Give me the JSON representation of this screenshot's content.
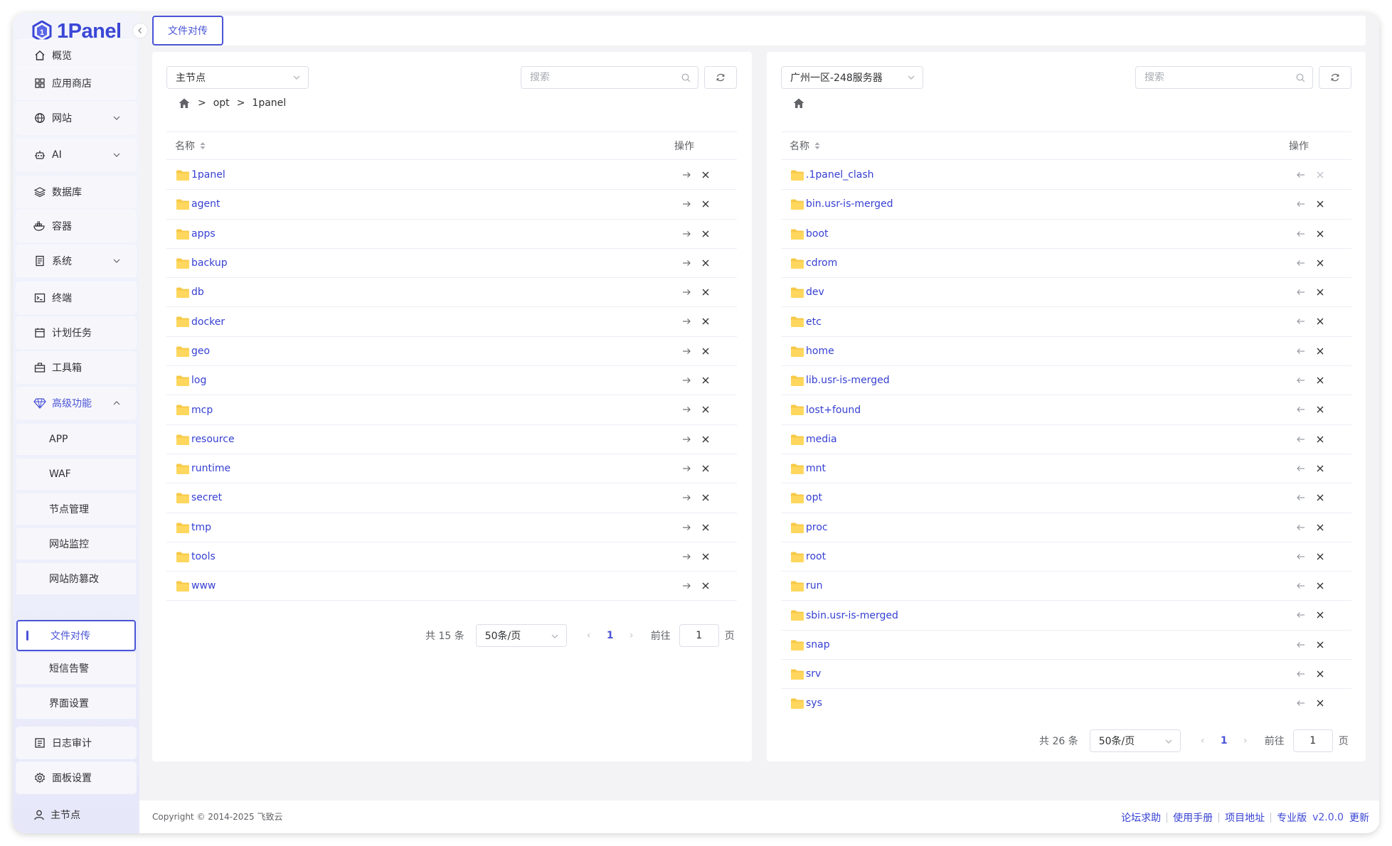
{
  "app": {
    "logo_text": "1Panel"
  },
  "sidebar": {
    "items": [
      {
        "label": "概览",
        "icon": "home-icon"
      },
      {
        "label": "应用商店",
        "icon": "grid-icon"
      },
      {
        "label": "网站",
        "icon": "globe-icon"
      },
      {
        "label": "AI",
        "icon": "robot-icon"
      },
      {
        "label": "数据库",
        "icon": "layers-icon"
      },
      {
        "label": "容器",
        "icon": "docker-icon"
      },
      {
        "label": "系统",
        "icon": "server-icon"
      },
      {
        "label": "终端",
        "icon": "terminal-icon"
      },
      {
        "label": "计划任务",
        "icon": "calendar-icon"
      },
      {
        "label": "工具箱",
        "icon": "toolbox-icon"
      },
      {
        "label": "高级功能",
        "icon": "diamond-icon"
      }
    ],
    "sub_items": [
      {
        "label": "APP"
      },
      {
        "label": "WAF"
      },
      {
        "label": "节点管理"
      },
      {
        "label": "网站监控"
      },
      {
        "label": "网站防篡改"
      },
      {
        "label": "文件对传"
      },
      {
        "label": "短信告警"
      },
      {
        "label": "界面设置"
      }
    ],
    "bottom_items": [
      {
        "label": "日志审计",
        "icon": "log-icon"
      },
      {
        "label": "面板设置",
        "icon": "settings-icon"
      }
    ],
    "user": "主节点"
  },
  "tabs": [
    {
      "label": "文件对传"
    }
  ],
  "left": {
    "node": "主节点",
    "search_placeholder": "搜索",
    "breadcrumb": [
      "opt",
      "1panel"
    ],
    "col_name": "名称",
    "col_action": "操作",
    "files": [
      "1panel",
      "agent",
      "apps",
      "backup",
      "db",
      "docker",
      "geo",
      "log",
      "mcp",
      "resource",
      "runtime",
      "secret",
      "tmp",
      "tools",
      "www"
    ],
    "total": "共 15 条",
    "page_size": "50条/页",
    "page": "1",
    "goto_label": "前往",
    "goto_value": "1",
    "page_suffix": "页"
  },
  "right": {
    "node": "广州一区-248服务器",
    "search_placeholder": "搜索",
    "col_name": "名称",
    "col_action": "操作",
    "files": [
      ".1panel_clash",
      "bin.usr-is-merged",
      "boot",
      "cdrom",
      "dev",
      "etc",
      "home",
      "lib.usr-is-merged",
      "lost+found",
      "media",
      "mnt",
      "opt",
      "proc",
      "root",
      "run",
      "sbin.usr-is-merged",
      "snap",
      "srv",
      "sys"
    ],
    "total": "共 26 条",
    "page_size": "50条/页",
    "page": "1",
    "goto_label": "前往",
    "goto_value": "1",
    "page_suffix": "页"
  },
  "footer": {
    "copyright": "Copyright © 2014-2025 飞致云",
    "links": [
      "论坛求助",
      "使用手册",
      "项目地址",
      "专业版"
    ],
    "version": "v2.0.0",
    "update": "更新"
  },
  "colors": {
    "accent": "#4a54d6",
    "link": "#3640d2",
    "folder": "#f7c948"
  }
}
